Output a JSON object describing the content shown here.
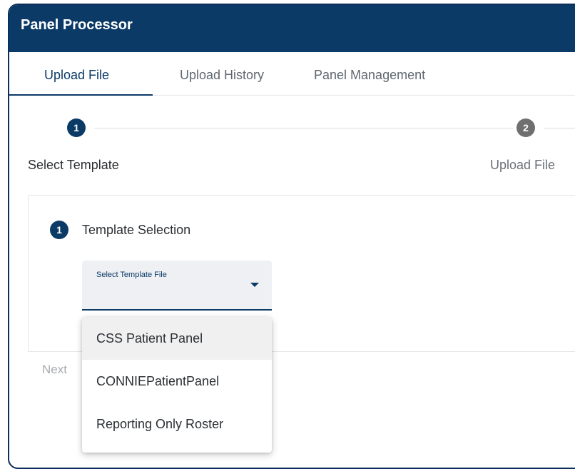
{
  "app": {
    "title": "Panel Processor"
  },
  "tabs": [
    {
      "label": "Upload File",
      "active": true
    },
    {
      "label": "Upload History",
      "active": false
    },
    {
      "label": "Panel Management",
      "active": false
    }
  ],
  "stepper": {
    "steps": [
      {
        "number": "1",
        "label": "Select Template",
        "state": "active"
      },
      {
        "number": "2",
        "label": "Upload File",
        "state": "inactive"
      }
    ]
  },
  "template_section": {
    "number": "1",
    "title": "Template Selection",
    "select": {
      "label": "Select Template File",
      "value": ""
    }
  },
  "navigation": {
    "next_label": "Next"
  },
  "dropdown": {
    "options": [
      {
        "label": "CSS Patient Panel",
        "highlighted": true
      },
      {
        "label": "CONNIEPatientPanel",
        "highlighted": false
      },
      {
        "label": "Reporting Only Roster",
        "highlighted": false
      }
    ]
  },
  "colors": {
    "primary": "#0b3a67",
    "inactive_step": "#6f6f6f",
    "highlight": "#f0f0f0"
  }
}
